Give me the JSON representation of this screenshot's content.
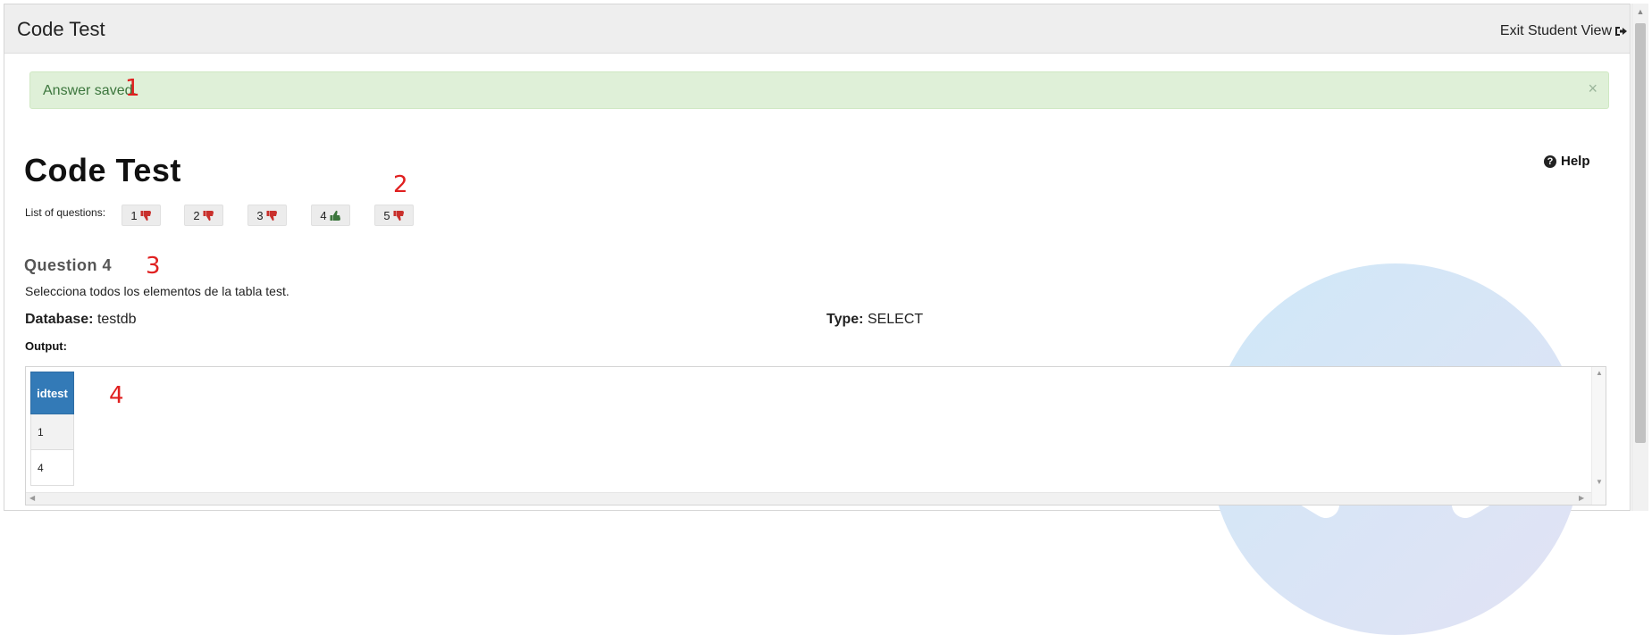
{
  "header": {
    "title": "Code Test",
    "exit_label": "Exit Student View"
  },
  "alert": {
    "message": "Answer saved.",
    "close_symbol": "×"
  },
  "annotations": [
    "1",
    "2",
    "3",
    "4"
  ],
  "page": {
    "title": "Code Test",
    "help_label": "Help",
    "help_icon": "question-circle-icon"
  },
  "questions": {
    "label": "List of questions:",
    "items": [
      {
        "number": "1",
        "status": "thumbs-down"
      },
      {
        "number": "2",
        "status": "thumbs-down"
      },
      {
        "number": "3",
        "status": "thumbs-down"
      },
      {
        "number": "4",
        "status": "thumbs-up"
      },
      {
        "number": "5",
        "status": "thumbs-down"
      }
    ]
  },
  "question": {
    "heading": "Question 4",
    "description": "Selecciona todos los elementos de la tabla test.",
    "database_label": "Database:",
    "database_value": "testdb",
    "type_label": "Type:",
    "type_value": "SELECT",
    "output_label": "Output:"
  },
  "output_table": {
    "columns": [
      "idtest"
    ],
    "rows": [
      [
        "1"
      ],
      [
        "4"
      ]
    ]
  },
  "colors": {
    "alert_bg": "#dff0d8",
    "alert_text": "#3c763d",
    "table_header": "#337ab7",
    "thumbs_down": "#c9302c",
    "thumbs_up": "#3c763d",
    "annotation": "#e02020"
  }
}
